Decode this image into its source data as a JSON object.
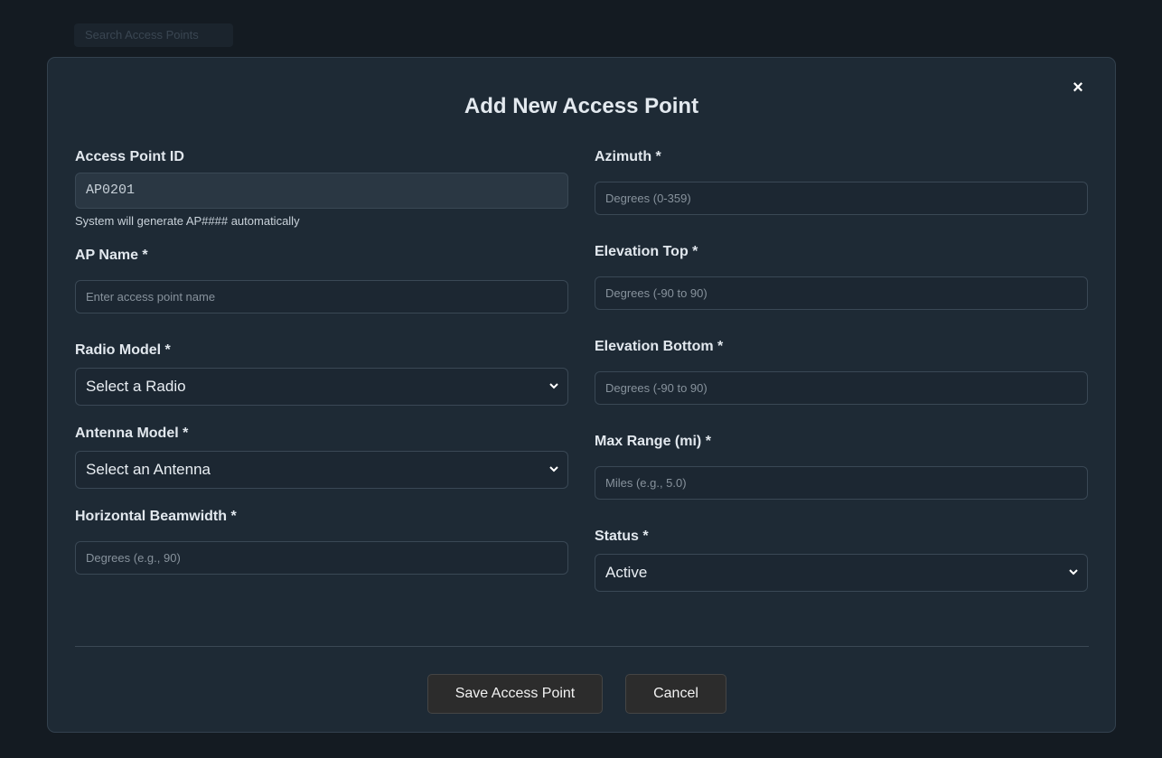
{
  "background": {
    "chip_text": "Search Access Points"
  },
  "modal": {
    "title": "Add New Access Point",
    "close_icon": "×",
    "left_fields": {
      "ap_id": {
        "label": "Access Point ID",
        "value": "AP0201",
        "hint": "System will generate AP#### automatically"
      },
      "ap_name": {
        "label": "AP Name *",
        "placeholder": "Enter access point name"
      },
      "radio_model": {
        "label": "Radio Model *",
        "selected": "Select a Radio"
      },
      "antenna_model": {
        "label": "Antenna Model *",
        "selected": "Select an Antenna"
      },
      "h_beamwidth": {
        "label": "Horizontal Beamwidth *",
        "placeholder": "Degrees (e.g., 90)"
      }
    },
    "right_fields": {
      "azimuth": {
        "label": "Azimuth *",
        "placeholder": "Degrees (0-359)"
      },
      "elevation_top": {
        "label": "Elevation Top *",
        "placeholder": "Degrees (-90 to 90)"
      },
      "elevation_bottom": {
        "label": "Elevation Bottom *",
        "placeholder": "Degrees (-90 to 90)"
      },
      "max_range": {
        "label": "Max Range (mi) *",
        "placeholder": "Miles (e.g., 5.0)"
      },
      "status": {
        "label": "Status *",
        "selected": "Active"
      }
    },
    "buttons": {
      "save": "Save Access Point",
      "cancel": "Cancel"
    }
  },
  "colors": {
    "modal_bg": "#1e2a35",
    "page_bg": "#141b22",
    "button_bg": "#2c2c2c"
  }
}
